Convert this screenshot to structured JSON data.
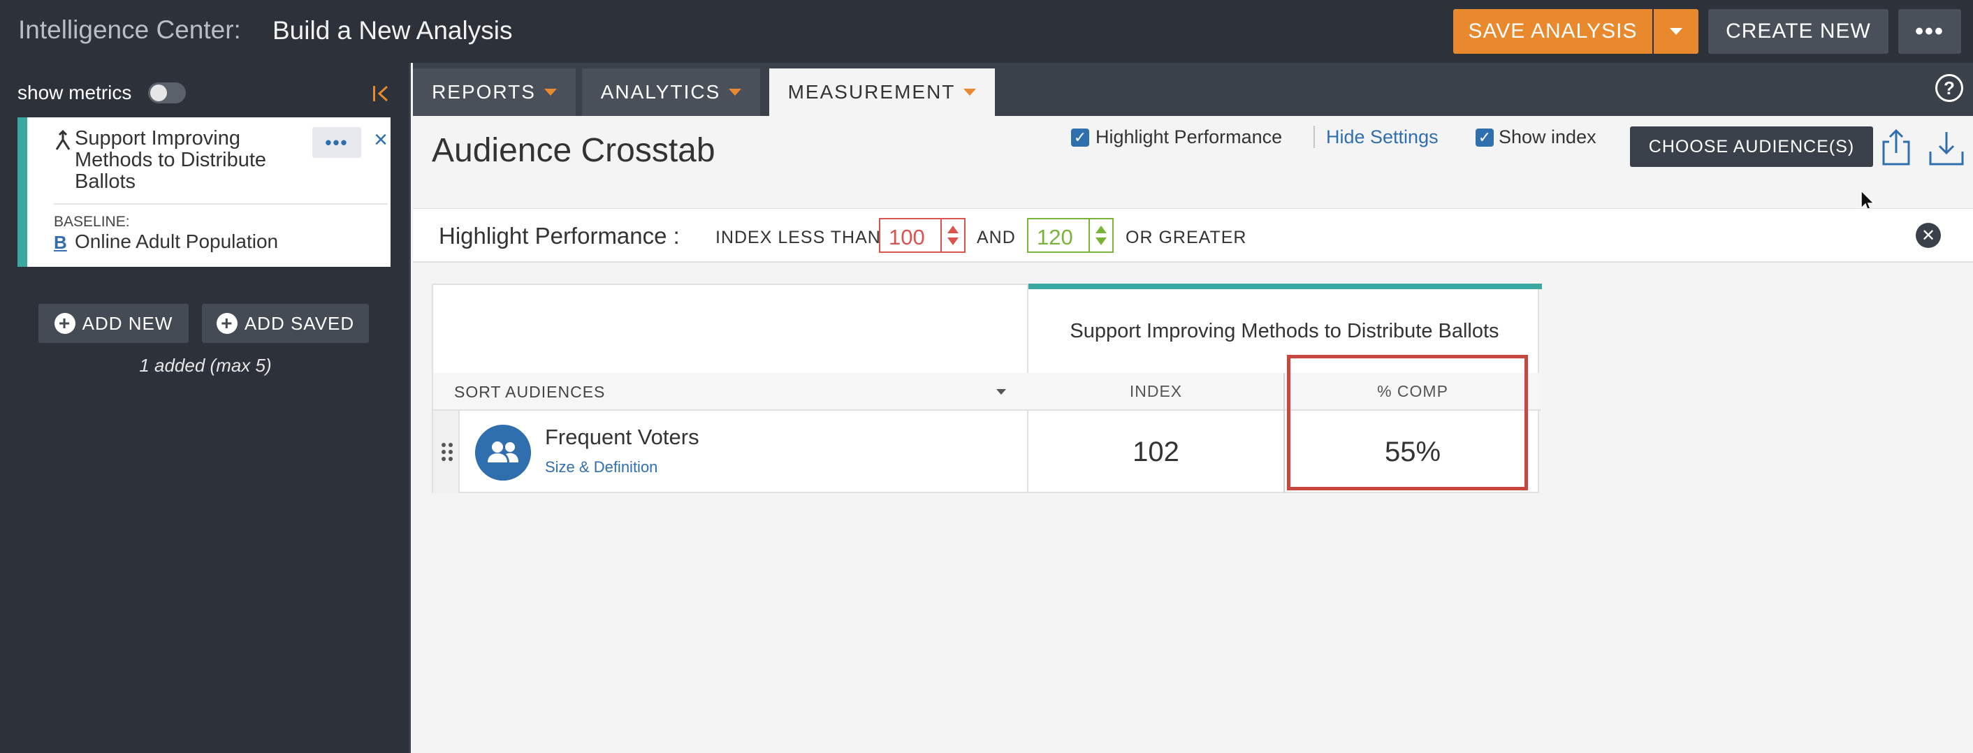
{
  "header": {
    "app_title": "Intelligence Center:",
    "page_title": "Build a New Analysis",
    "save_label": "SAVE ANALYSIS",
    "create_label": "CREATE NEW",
    "more_label": "•••"
  },
  "sidebar": {
    "show_metrics_label": "show metrics",
    "show_metrics_on": false,
    "audience_card": {
      "name": "Support Improving Methods to Distribute Ballots",
      "more_label": "•••",
      "close_label": "×",
      "baseline_label": "BASELINE:",
      "baseline_badge": "B",
      "baseline_value": "Online Adult Population"
    },
    "add_new_label": "ADD NEW",
    "add_saved_label": "ADD SAVED",
    "added_count": "1 added (max 5)"
  },
  "tabs": [
    {
      "label": "REPORTS",
      "active": false
    },
    {
      "label": "ANALYTICS",
      "active": false
    },
    {
      "label": "MEASUREMENT",
      "active": true
    }
  ],
  "help_label": "?",
  "main": {
    "title": "Audience Crosstab",
    "highlight_checkbox_label": "Highlight Performance",
    "highlight_checked": true,
    "hide_settings_label": "Hide Settings",
    "show_index_label": "Show index",
    "show_index_checked": true,
    "choose_audiences_label": "CHOOSE AUDIENCE(S)"
  },
  "highlight_bar": {
    "title": "Highlight Performance :",
    "less_than_label": "INDEX LESS THAN",
    "low_value": "100",
    "and_label": "AND",
    "high_value": "120",
    "greater_label": "OR GREATER",
    "close_label": "✕"
  },
  "crosstab": {
    "column_header": "Support Improving Methods to Distribute Ballots",
    "sort_label": "SORT AUDIENCES",
    "metric_headers": [
      "INDEX",
      "% COMP"
    ],
    "rows": [
      {
        "audience": "Frequent Voters",
        "link": "Size & Definition",
        "index": "102",
        "comp": "55%"
      }
    ]
  },
  "colors": {
    "accent_orange": "#e8892e",
    "teal": "#3aa7a0",
    "link_blue": "#2f6fae",
    "low_red": "#d9534f",
    "high_green": "#7bb33a",
    "highlight_box": "#c7463d"
  }
}
